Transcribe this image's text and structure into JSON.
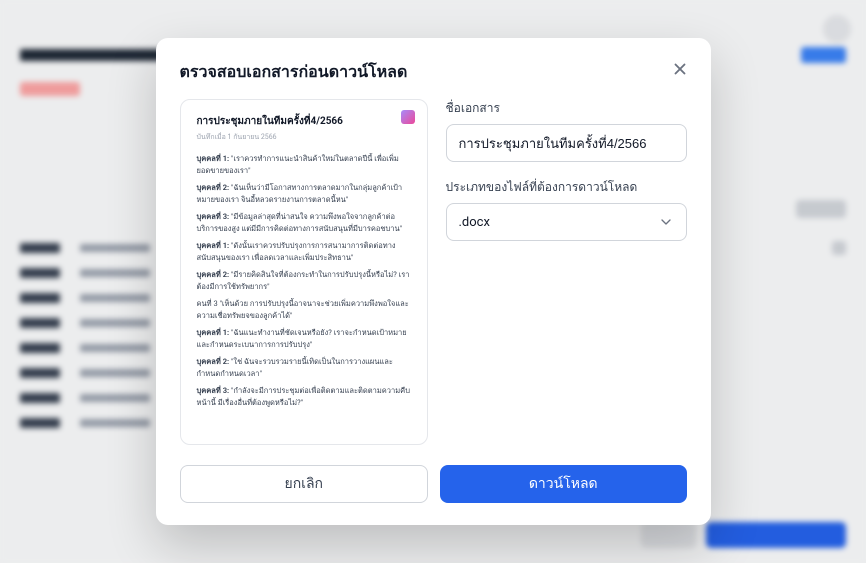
{
  "modal": {
    "title": "ตรวจสอบเอกสารก่อนดาวน์โหลด",
    "preview": {
      "doc_title": "การประชุมภายในทีมครั้งที่4/2566",
      "doc_subtitle": "บันทึกเมื่อ 1 กันยายน 2566",
      "lines": [
        {
          "label": "บุคคลที่ 1:",
          "text": "\"เราควรทำการแนะนำสินค้าใหม่ในตลาดปีนี้ เพื่อเพิ่มยอดขายของเรา\""
        },
        {
          "label": "บุคคลที่ 2:",
          "text": "\"ฉันเห็นว่ามีโอกาสทางการตลาดมากในกลุ่มลูกค้าเป้าหมายของเรา จินอี้หลวดรายงานการตลาดนี้หน\""
        },
        {
          "label": "บุคคลที่ 3:",
          "text": "\"มีข้อมูลล่าสุดที่น่าสนใจ ความพึงพอใจจากลูกค้าต่อบริการของสูง แต่มีมีการคิดต่อทางการสนับสนุนที่มีบารคอชบาน\""
        },
        {
          "label": "บุคคลที่ 1:",
          "text": "\"ดังนั้นเราควรปรับปรุงการการสนามาการติดต่อทางสนับสนุนของเรา เพื่อลดเวลาและเพิ่มประสิทธาน\""
        },
        {
          "label": "บุคคลที่ 2:",
          "text": "\"มีรายคิดสินใจที่ต้องกระทำในการปรับปรุงนี้หรือไม่? เราต้องมีการใช้ทรัพยากร\""
        },
        {
          "label": "",
          "text": "คนที่ 3 \"เห็นด้วย การปรับปรุงนี้อาจนาจะช่วยเพิ่มความพึงพอใจและความเชื่อทรัพยจของลูกค้าได้\""
        },
        {
          "label": "บุคคลที่ 1:",
          "text": "\"ฉันแนะทำงานที่ชัดเจนหรือยัง? เราจะกำหนดเป้าหมายและกำหนดระเบนาการการปรับปรุง\""
        },
        {
          "label": "บุคคลที่ 2:",
          "text": "\"ใช่ ฉันจะรวบรวมรายนี้เทิดเป็นในการวางแผนและกำหนดกำหนดเวลา\""
        },
        {
          "label": "บุคคลที่ 3:",
          "text": "\"กำลังจะมีการประชุมต่อเพื่อติดตามและติดตามความคืบหน้านี้ มีเรื่องอื่นที่ต้องพูดหรือไม่?\""
        }
      ]
    },
    "form": {
      "name_label": "ชื่อเอกสาร",
      "name_value": "การประชุมภายในทีมครั้งที่4/2566",
      "filetype_label": "ประเภทของไฟล์ที่ต้องการดาวน์โหลด",
      "filetype_value": ".docx"
    },
    "footer": {
      "cancel": "ยกเลิก",
      "download": "ดาวน์โหลด"
    }
  }
}
